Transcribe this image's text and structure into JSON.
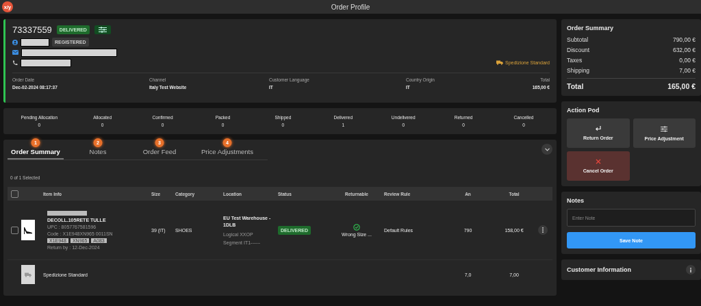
{
  "app": {
    "logo": "x/y",
    "title": "Order Profile"
  },
  "order": {
    "number": "73337559",
    "status": "DELIVERED",
    "customer_badge": "REGISTERED",
    "shipping_method": "Spedizione Standard",
    "fields": [
      {
        "label": "Order Date",
        "value": "Dec-02-2024 08:17:37"
      },
      {
        "label": "Channel",
        "value": "Italy Test Website"
      },
      {
        "label": "Customer Language",
        "value": "IT"
      },
      {
        "label": "Country Origin",
        "value": "IT"
      },
      {
        "label": "Total",
        "value": "165,00 €"
      }
    ]
  },
  "status_counts": [
    {
      "label": "Pending Allocation",
      "count": "0"
    },
    {
      "label": "Allocated",
      "count": "0"
    },
    {
      "label": "Confirmed",
      "count": "0"
    },
    {
      "label": "Packed",
      "count": "0"
    },
    {
      "label": "Shipped",
      "count": "0"
    },
    {
      "label": "Delivered",
      "count": "1"
    },
    {
      "label": "Undelivered",
      "count": "0"
    },
    {
      "label": "Returned",
      "count": "0"
    },
    {
      "label": "Cancelled",
      "count": "0"
    }
  ],
  "tabs": [
    {
      "label": "Order Summary",
      "badge": "1",
      "selected": true
    },
    {
      "label": "Notes",
      "badge": "2",
      "selected": false
    },
    {
      "label": "Order Feed",
      "badge": "3",
      "selected": false
    },
    {
      "label": "Price Adjustments",
      "badge": "4",
      "selected": false
    }
  ],
  "table": {
    "selection": "0 of 1 Selected",
    "select_all_checked": false,
    "columns": [
      "Item Info",
      "Size",
      "Category",
      "Location",
      "Status",
      "Returnable",
      "Review Rule",
      "An",
      "Total"
    ],
    "rows": [
      {
        "kind": "item",
        "checked": false,
        "name": "DECOLL.105RETE TULLE",
        "upc": "UPC : 8057767581596",
        "code": "Code : X1E948XN965 0011SN",
        "tags": [
          "X1E948",
          "XN965",
          "A083"
        ],
        "return_by": "Return by : 12-Dec-2024",
        "size": "39 (IT)",
        "category": "SHOES",
        "location": [
          "EU Test Warehouse - 1DLB",
          "Logical XXOP",
          "Segment IT1------"
        ],
        "status": "DELIVERED",
        "returnable": "Wrong Size ...",
        "review_rule": "Default Rules",
        "amount": "790",
        "total": "158,00 €"
      },
      {
        "kind": "shipping",
        "name": "Spedizione Standard",
        "amount": "7,0",
        "total": "7,00"
      }
    ]
  },
  "summary": {
    "title": "Order Summary",
    "lines": [
      {
        "label": "Subtotal",
        "value": "790,00 €"
      },
      {
        "label": "Discount",
        "value": "632,00 €"
      },
      {
        "label": "Taxes",
        "value": "0,00 €"
      },
      {
        "label": "Shipping",
        "value": "7,00 €"
      }
    ],
    "total_label": "Total",
    "total_value": "165,00 €"
  },
  "action_pod": {
    "title": "Action Pod",
    "actions": [
      {
        "kind": "return",
        "label": "Return Order"
      },
      {
        "kind": "adjust",
        "label": "Price Adjustment"
      },
      {
        "kind": "cancel",
        "label": "Cancel Order"
      }
    ]
  },
  "notes": {
    "title": "Notes",
    "placeholder": "Enter Note",
    "button": "Save Note"
  },
  "customer_info": {
    "title": "Customer Information"
  }
}
